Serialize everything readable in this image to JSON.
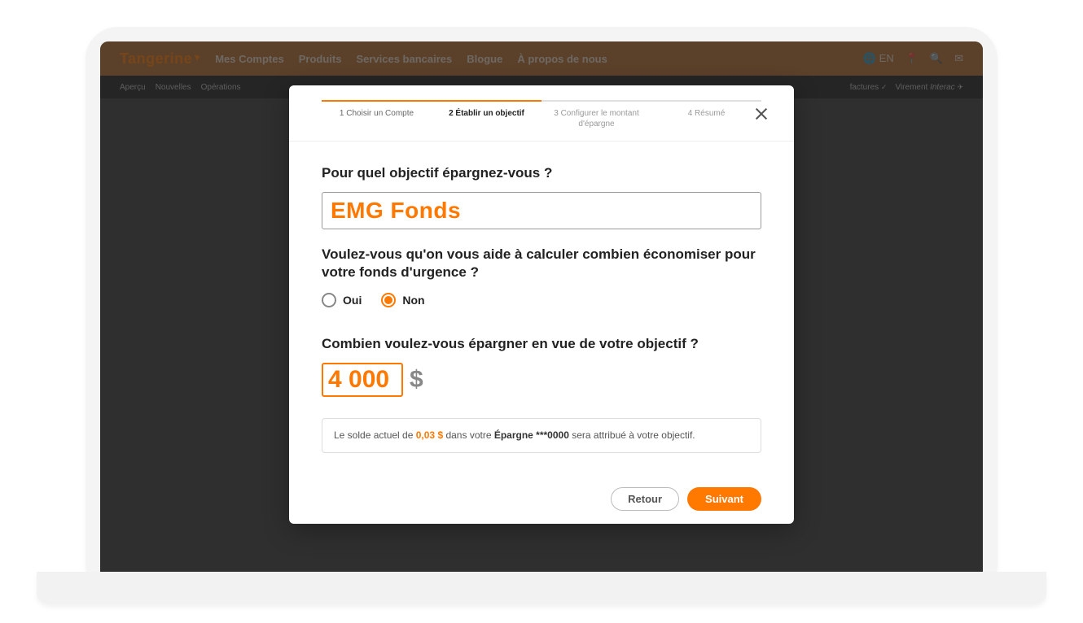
{
  "brand": "Tangerine",
  "header": {
    "nav": [
      "Mes Comptes",
      "Produits",
      "Services bancaires",
      "Blogue",
      "À propos de nous"
    ],
    "lang": "EN"
  },
  "subnav": {
    "left": [
      "Aperçu",
      "Nouvelles",
      "Opérations"
    ],
    "right_factures": "factures",
    "right_virement_prefix": "Virement ",
    "right_virement_italic": "Interac"
  },
  "modal": {
    "steps": [
      "1 Choisir un Compte",
      "2 Établir un objectif",
      "3 Configurer le montant d'épargne",
      "4 Résumé"
    ],
    "q_goal": "Pour quel objectif épargnez-vous ?",
    "goal_value": "EMG Fonds",
    "q_help": "Voulez-vous qu'on vous aide à calculer combien économiser pour votre fonds d'urgence ?",
    "radio_yes": "Oui",
    "radio_no": "Non",
    "radio_selected": "no",
    "q_amount": "Combien voulez-vous épargner en vue de votre objectif ?",
    "amount_value": "4 000",
    "currency": "$",
    "info": {
      "prefix": "Le solde actuel de ",
      "balance": "0,03 $",
      "mid": " dans votre ",
      "account": "Épargne ***0000",
      "suffix": " sera attribué à votre objectif."
    },
    "back_label": "Retour",
    "next_label": "Suivant"
  }
}
